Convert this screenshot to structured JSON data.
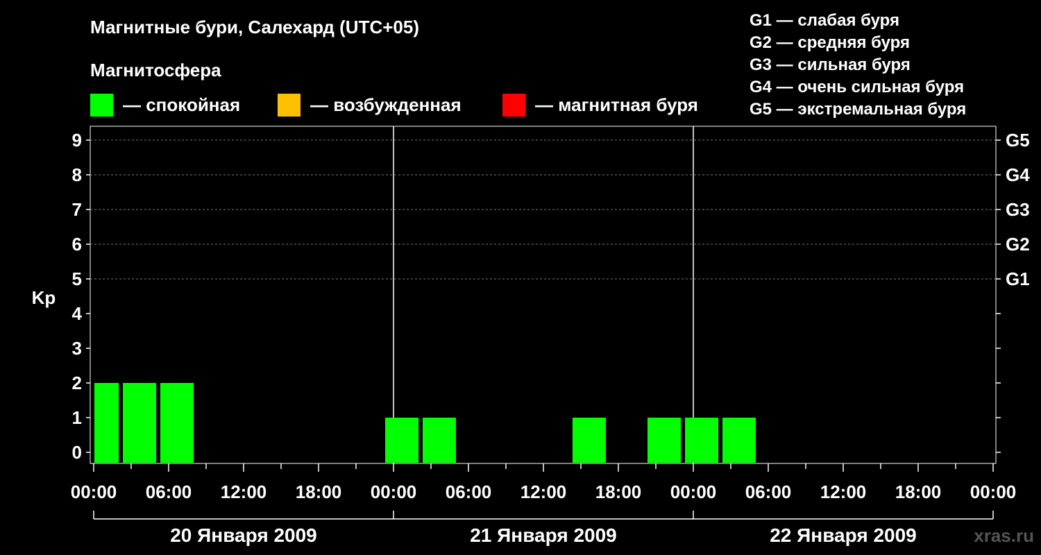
{
  "header": {
    "title": "Магнитные бури, Салехард (UTC+05)",
    "subtitle": "Магнитосфера"
  },
  "legend": [
    {
      "label": "— спокойная",
      "color": "#00ff00"
    },
    {
      "label": "— возбужденная",
      "color": "#ffc000"
    },
    {
      "label": "— магнитная буря",
      "color": "#ff0000"
    }
  ],
  "storm_legend": [
    "G1 — слабая буря",
    "G2 — средняя буря",
    "G3 — сильная буря",
    "G4 — очень сильная буря",
    "G5 — экстремальная буря"
  ],
  "watermark": "xras.ru",
  "chart_data": {
    "type": "bar",
    "ylabel": "Kp",
    "ylim": [
      0,
      9
    ],
    "yticks": [
      "0",
      "1",
      "2",
      "3",
      "4",
      "5",
      "6",
      "7",
      "8",
      "9"
    ],
    "right_ticks": [
      {
        "value": 5,
        "label": "G1"
      },
      {
        "value": 6,
        "label": "G2"
      },
      {
        "value": 7,
        "label": "G3"
      },
      {
        "value": 8,
        "label": "G4"
      },
      {
        "value": 9,
        "label": "G5"
      }
    ],
    "xticks": [
      "00:00",
      "06:00",
      "12:00",
      "18:00",
      "00:00",
      "06:00",
      "12:00",
      "18:00",
      "00:00",
      "06:00",
      "12:00",
      "18:00",
      "00:00"
    ],
    "days": [
      "20 Января 2009",
      "21 Января 2009",
      "22 Января 2009"
    ],
    "grid": "dashed horizontal at 5-9",
    "bar_color": "#00ff00",
    "bars": [
      {
        "start_hour": 0,
        "end_hour": 2,
        "kp": 2
      },
      {
        "start_hour": 2,
        "end_hour": 5,
        "kp": 2
      },
      {
        "start_hour": 5,
        "end_hour": 8,
        "kp": 2
      },
      {
        "start_hour": 23,
        "end_hour": 26,
        "kp": 1
      },
      {
        "start_hour": 26,
        "end_hour": 29,
        "kp": 1
      },
      {
        "start_hour": 38,
        "end_hour": 41,
        "kp": 1
      },
      {
        "start_hour": 44,
        "end_hour": 47,
        "kp": 1
      },
      {
        "start_hour": 47,
        "end_hour": 50,
        "kp": 1
      },
      {
        "start_hour": 50,
        "end_hour": 53,
        "kp": 1
      }
    ]
  }
}
